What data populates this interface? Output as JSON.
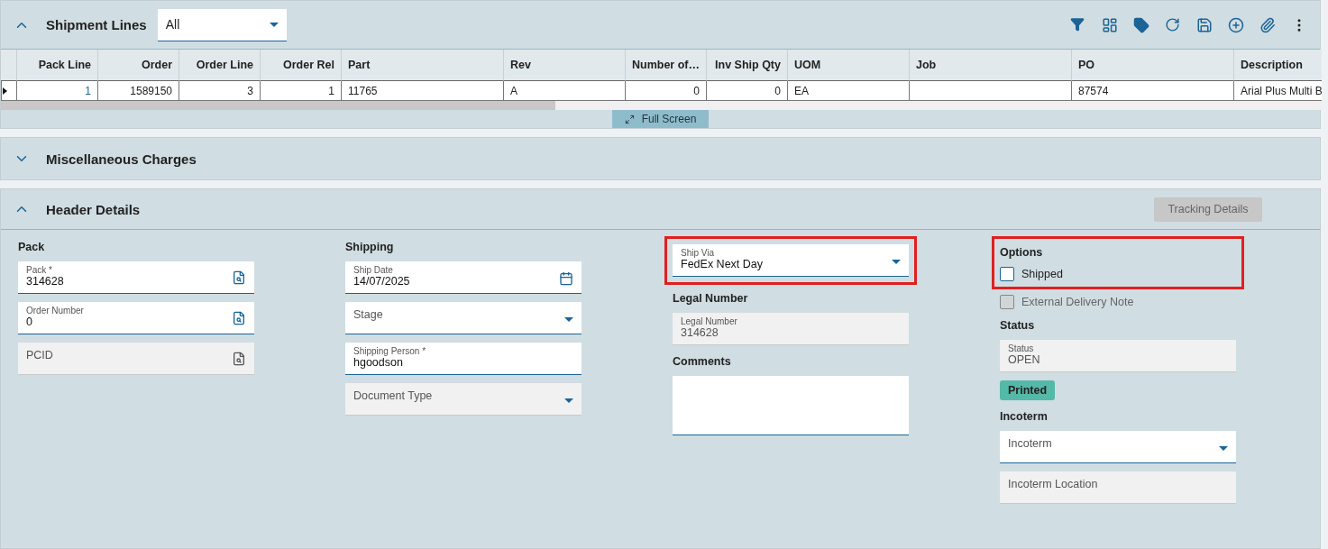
{
  "shipment_lines": {
    "title": "Shipment Lines",
    "expanded": true,
    "filter": {
      "value": "All"
    },
    "columns": [
      {
        "label": "Pack Line",
        "kind": "number"
      },
      {
        "label": "Order",
        "kind": "number"
      },
      {
        "label": "Order Line",
        "kind": "number"
      },
      {
        "label": "Order Rel",
        "kind": "number"
      },
      {
        "label": "Part",
        "kind": "text"
      },
      {
        "label": "Rev",
        "kind": "text"
      },
      {
        "label": "Number of…",
        "kind": "number"
      },
      {
        "label": "Inv Ship Qty",
        "kind": "number"
      },
      {
        "label": "UOM",
        "kind": "text"
      },
      {
        "label": "Job",
        "kind": "text"
      },
      {
        "label": "PO",
        "kind": "text"
      },
      {
        "label": "Description",
        "kind": "text"
      }
    ],
    "rows": [
      {
        "selected": true,
        "cells": [
          "1",
          "1589150",
          "3",
          "1",
          "11765",
          "A",
          "0",
          "0",
          "EA",
          "",
          "87574",
          "Arial Plus Multi B"
        ]
      }
    ],
    "full_screen_button": "Full Screen"
  },
  "misc_charges": {
    "title": "Miscellaneous Charges",
    "expanded": false
  },
  "header_details": {
    "title": "Header Details",
    "expanded": true,
    "tracking_button": {
      "label": "Tracking Details",
      "disabled": true
    },
    "columns": [
      [
        {
          "kind": "heading",
          "text": "Pack"
        },
        {
          "kind": "lookup",
          "label": "Pack *",
          "value": "314628",
          "disabled": false
        },
        {
          "kind": "lookup",
          "label": "Order Number",
          "value": "0",
          "disabled": false
        },
        {
          "kind": "lookup",
          "label": "PCID",
          "disabled": true
        }
      ],
      [
        {
          "kind": "heading",
          "text": "Shipping"
        },
        {
          "kind": "date",
          "label": "Ship Date",
          "value": "14/07/2025",
          "disabled": false
        },
        {
          "kind": "select",
          "label": "Stage",
          "disabled": false
        },
        {
          "kind": "text",
          "label": "Shipping Person *",
          "value": "hgoodson",
          "disabled": false
        },
        {
          "kind": "select",
          "label": "Document Type",
          "disabled": true
        }
      ],
      [
        {
          "kind": "highlight",
          "children": [
            {
              "kind": "select",
              "label": "Ship Via",
              "value": "FedEx Next Day",
              "disabled": false
            }
          ]
        },
        {
          "kind": "heading",
          "text": "Legal Number"
        },
        {
          "kind": "text",
          "label": "Legal Number",
          "value": "314628",
          "disabled": true
        },
        {
          "kind": "heading",
          "text": "Comments"
        },
        {
          "kind": "textarea",
          "disabled": false
        }
      ],
      [
        {
          "kind": "highlight",
          "children": [
            {
              "kind": "heading",
              "text": "Options"
            },
            {
              "kind": "checkbox",
              "label": "Shipped",
              "checked": false,
              "disabled": false
            }
          ]
        },
        {
          "kind": "checkbox",
          "label": "External Delivery Note",
          "checked": false,
          "disabled": true
        },
        {
          "kind": "heading",
          "text": "Status"
        },
        {
          "kind": "text",
          "label": "Status",
          "value": "OPEN",
          "disabled": true
        },
        {
          "kind": "badge",
          "text": "Printed"
        },
        {
          "kind": "heading",
          "text": "Incoterm"
        },
        {
          "kind": "select",
          "label": "Incoterm",
          "disabled": false
        },
        {
          "kind": "text",
          "label": "Incoterm Location",
          "disabled": true
        }
      ]
    ]
  }
}
